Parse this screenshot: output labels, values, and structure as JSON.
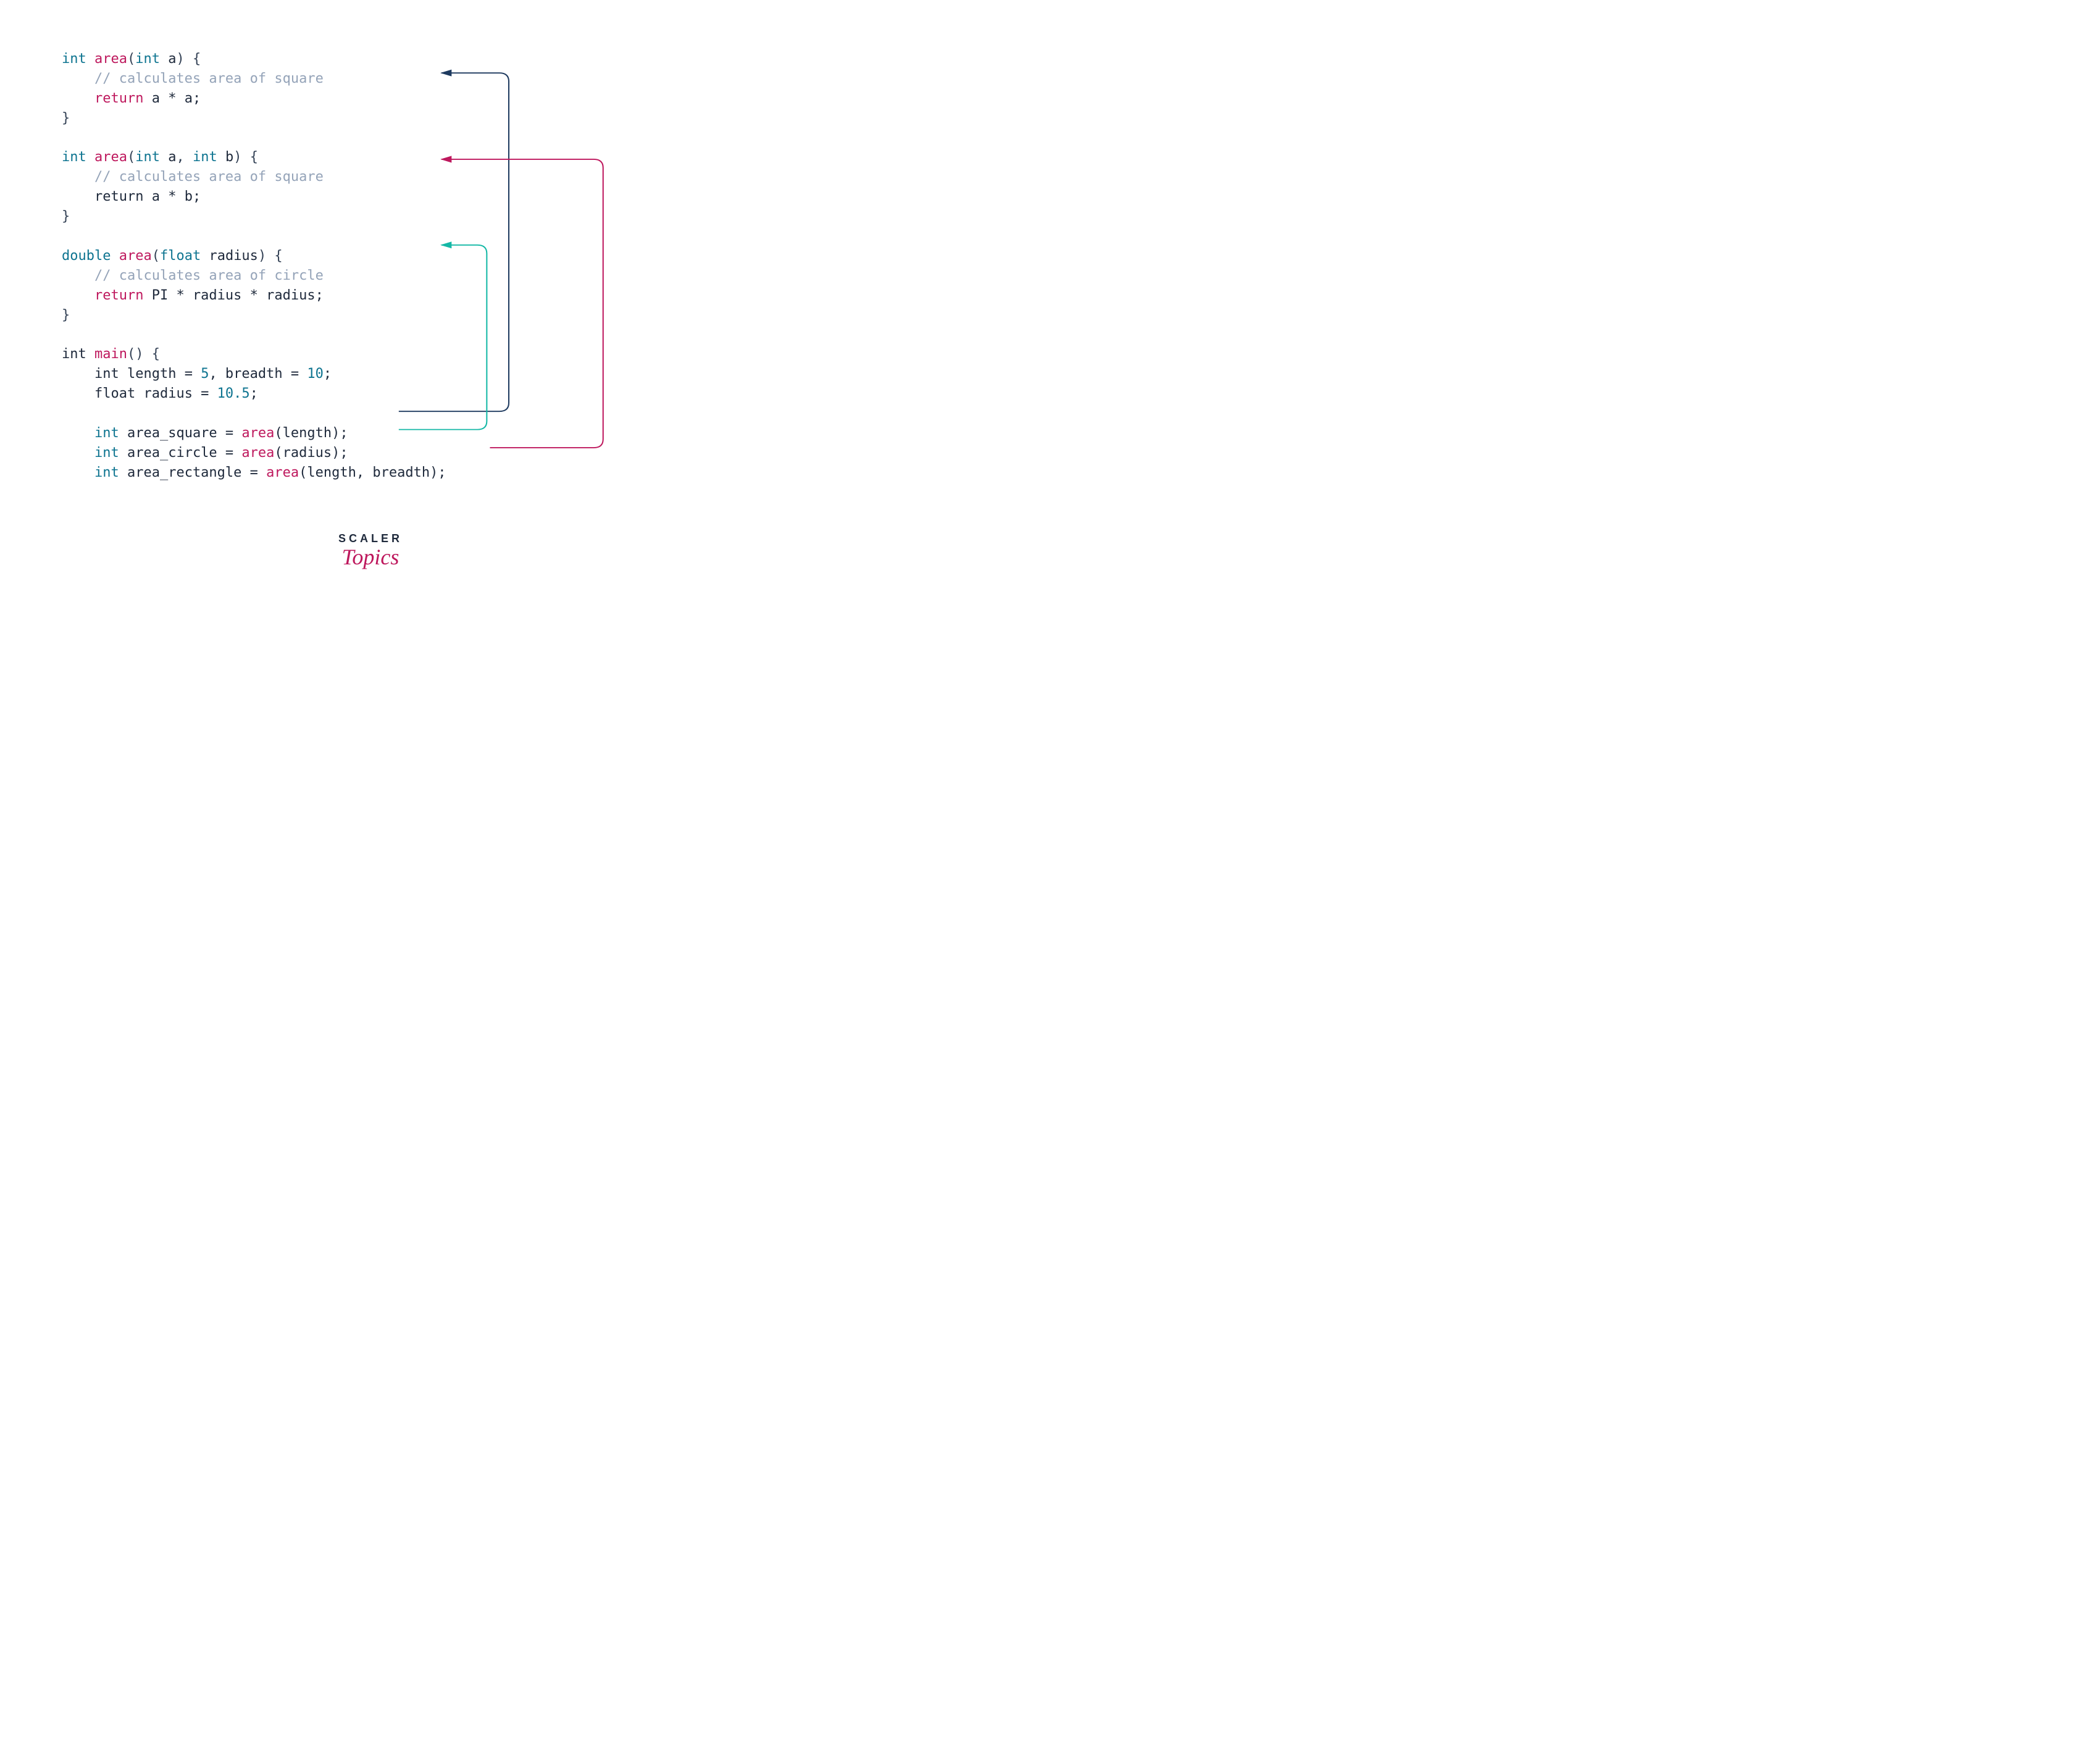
{
  "code": {
    "fn1": {
      "type": "int",
      "name": "area",
      "param_type": "int",
      "param_name": "a",
      "open": " {",
      "comment": "// calculates area of square",
      "return_kw": "return",
      "return_expr": " a * a;",
      "close": "}"
    },
    "fn2": {
      "type": "int",
      "name": "area",
      "param1_type": "int",
      "param1_name": "a",
      "comma": ", ",
      "param2_type": "int",
      "param2_name": "b",
      "open": " {",
      "comment": "// calculates area of square",
      "return_kw": "return",
      "return_expr": " a * b;",
      "close": "}"
    },
    "fn3": {
      "type": "double",
      "name": "area",
      "param_type": "float",
      "param_name": "radius",
      "open": " {",
      "comment": "// calculates area of circle",
      "return_kw": "return",
      "return_expr": " PI * radius * radius;",
      "close": "}"
    },
    "main": {
      "type": "int",
      "name": "main",
      "open": "() {",
      "decl1_type": "int",
      "decl1_rest": " length = ",
      "decl1_val1": "5",
      "decl1_mid": ", breadth = ",
      "decl1_val2": "10",
      "decl1_end": ";",
      "decl2_type": "float",
      "decl2_rest": " radius = ",
      "decl2_val": "10.5",
      "decl2_end": ";",
      "call1_type": "int",
      "call1_var": " area_square = ",
      "call1_fn": "area",
      "call1_args": "(length);",
      "call2_type": "int",
      "call2_var": " area_circle = ",
      "call2_fn": "area",
      "call2_args": "(radius);",
      "call3_type": "int",
      "call3_var": " area_rectangle = ",
      "call3_fn": "area",
      "call3_args": "(length, breadth);"
    }
  },
  "footer": {
    "brand": "SCALER",
    "sub": "Topics"
  },
  "arrows": {
    "color_navy": "#1e3a5f",
    "color_pink": "#be185d",
    "color_teal": "#14b8a6"
  }
}
